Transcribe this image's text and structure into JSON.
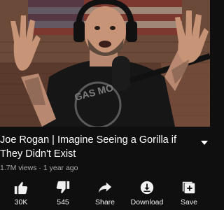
{
  "video": {
    "title": "Joe Rogan | Imagine Seeing a Gorilla if They Didn't Exist",
    "meta": "1.7M views · 1 year ago"
  },
  "actions": [
    {
      "icon": "thumbs-up-icon",
      "label": "30K"
    },
    {
      "icon": "thumbs-down-icon",
      "label": "545"
    },
    {
      "icon": "share-icon",
      "label": "Share"
    },
    {
      "icon": "download-icon",
      "label": "Download"
    },
    {
      "icon": "save-playlist-icon",
      "label": "Save"
    }
  ],
  "thumbnail": {
    "shirt_text": "GAS MO",
    "description": ""
  },
  "colors": {
    "background": "#0f0f0f",
    "text": "#ffffff",
    "secondary_text": "#aaaaaa"
  }
}
